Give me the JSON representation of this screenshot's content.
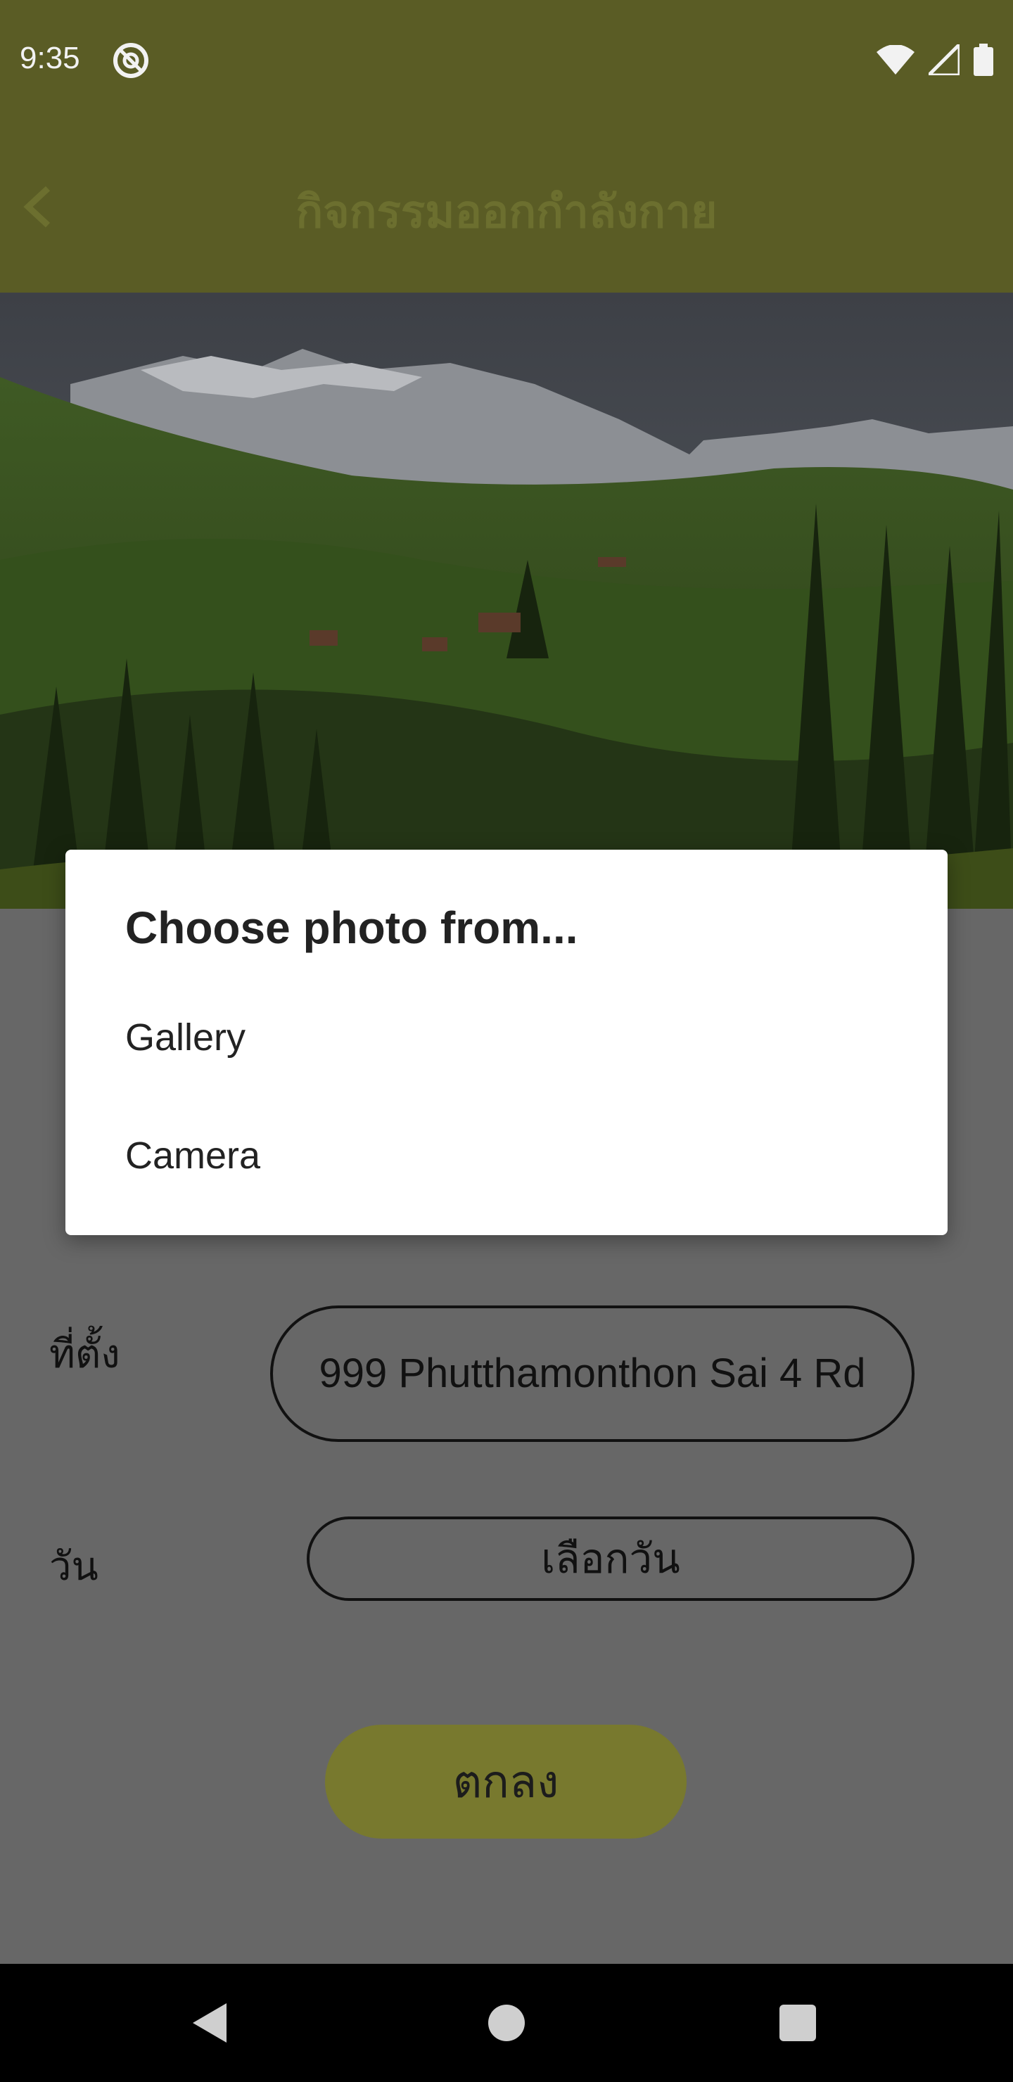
{
  "status_bar": {
    "time": "9:35"
  },
  "app_bar": {
    "title": "กิจกรรมออกกำลังกาย"
  },
  "form": {
    "location_label": "ที่ตั้ง",
    "location_value": "999 Phutthamonthon Sai 4 Rd",
    "date_label": "วัน",
    "date_value": "เลือกวัน",
    "submit_label": "ตกลง"
  },
  "dialog": {
    "title": "Choose photo from...",
    "options": [
      "Gallery",
      "Camera"
    ]
  },
  "colors": {
    "app_bar": "#5a5c25",
    "submit_button": "#78792e",
    "dialog_bg": "#ffffff"
  }
}
